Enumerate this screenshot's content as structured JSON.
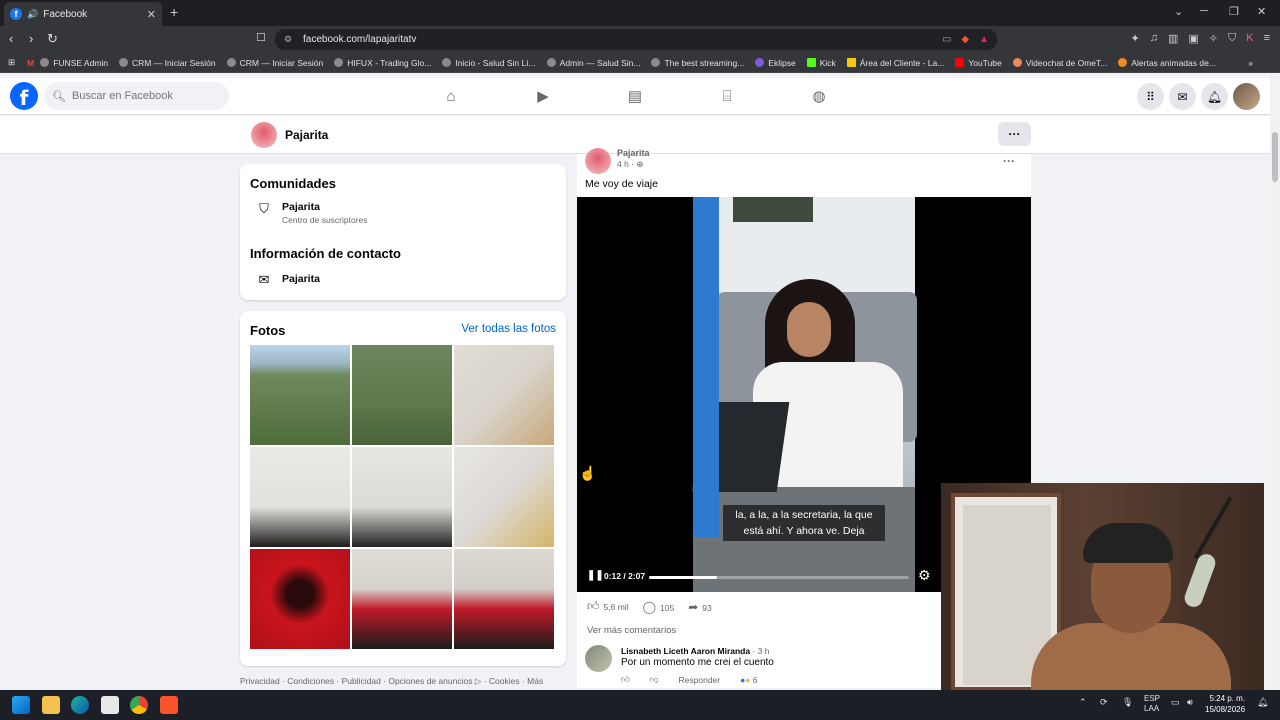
{
  "browser": {
    "tab_title": "Facebook",
    "tab_close": "✕",
    "new_tab": "+",
    "url": "facebook.com/lapajaritatv",
    "bookmarks": [
      {
        "label": "FUNSE Admin"
      },
      {
        "label": "CRM — Iniciar Sesión"
      },
      {
        "label": "CRM — Iniciar Sesión"
      },
      {
        "label": "HIFUX - Trading Glo..."
      },
      {
        "label": "Inicio - Salud Sin Lí..."
      },
      {
        "label": "Admin — Salud Sin..."
      },
      {
        "label": "The best streaming..."
      },
      {
        "label": "Eklipse"
      },
      {
        "label": "Kick"
      },
      {
        "label": "Área del Cliente - La..."
      },
      {
        "label": "YouTube"
      },
      {
        "label": "Videochat de OmeT..."
      },
      {
        "label": "Alertas animadas de..."
      }
    ]
  },
  "fb_header": {
    "logo": "f",
    "search_placeholder": "Buscar en Facebook"
  },
  "page": {
    "name": "Pajarita",
    "more": "···"
  },
  "communities": {
    "title": "Comunidades",
    "item_title": "Pajarita",
    "item_sub": "Centro de suscriptores"
  },
  "contact": {
    "title": "Información de contacto",
    "item_title": "Pajarita"
  },
  "photos": {
    "title": "Fotos",
    "see_all": "Ver todas las fotos",
    "tiles": [
      {
        "color": "#6f8a5c"
      },
      {
        "color": "#5d7a49"
      },
      {
        "color": "#d9d5cc"
      },
      {
        "color": "#e2e0dc"
      },
      {
        "color": "#dcdad6"
      },
      {
        "color": "#dddad5"
      },
      {
        "color": "#c8141c"
      },
      {
        "color": "#d6d1cb"
      },
      {
        "color": "#d3cec8"
      }
    ]
  },
  "footer": {
    "text": "Privacidad · Condiciones · Publicidad · Opciones de anuncios ▷ · Cookies · Más"
  },
  "post": {
    "author": "Pajarita",
    "time": "4 h · ",
    "text": "Me voy de viaje",
    "subtitle": "la, a la, a la secretaria, la que está ahí. Y ahora ve. Deja",
    "video_time": "0:12 / 2:07",
    "progress_fraction": 0.26,
    "likes": "5,6 mil",
    "comments": "105",
    "shares": "93",
    "more_comments": "Ver más comentarios",
    "comment": {
      "author": "Lisnabeth Liceth Aaron Miranda",
      "time": " · 3 h",
      "text": "Por un momento me crei el cuento",
      "reply": "Responder",
      "reactions": "6"
    }
  },
  "taskbar": {
    "lang1": "ESP",
    "lang2": "LAA",
    "time": "5:24 p. m.",
    "date": "15/08/2026"
  }
}
